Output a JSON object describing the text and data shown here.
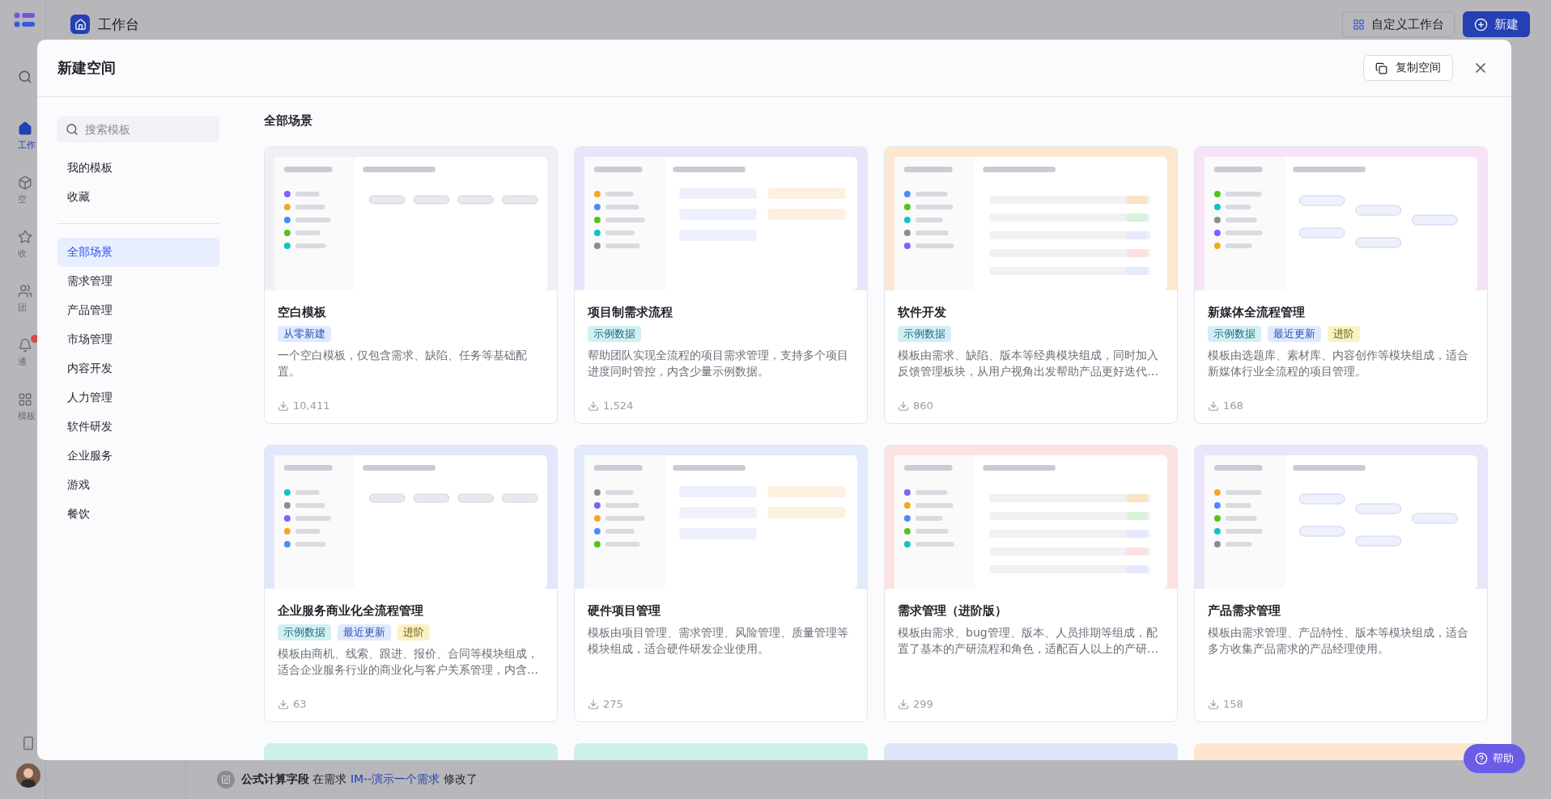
{
  "app": {
    "rail": [
      {
        "label": "工作",
        "selected": true
      },
      {
        "label": "空",
        "selected": false
      },
      {
        "label": "收",
        "selected": false
      },
      {
        "label": "团",
        "selected": false
      },
      {
        "label": "通",
        "selected": false,
        "badge": true
      },
      {
        "label": "模板",
        "selected": false
      }
    ],
    "topbar": {
      "title": "工作台",
      "customize_button": "自定义工作台",
      "new_button": "新建"
    },
    "activity": {
      "field": "公式计算字段",
      "middle": "在需求",
      "link": "IM--演示一个需求",
      "action": "修改了"
    },
    "help_button": "帮助"
  },
  "modal": {
    "title": "新建空间",
    "copy_button": "复制空间",
    "search": {
      "placeholder": "搜索模板"
    },
    "personal_items": [
      {
        "label": "我的模板"
      },
      {
        "label": "收藏"
      }
    ],
    "categories": [
      {
        "label": "全部场景",
        "selected": true
      },
      {
        "label": "需求管理",
        "selected": false
      },
      {
        "label": "产品管理",
        "selected": false
      },
      {
        "label": "市场管理",
        "selected": false
      },
      {
        "label": "内容开发",
        "selected": false
      },
      {
        "label": "人力管理",
        "selected": false
      },
      {
        "label": "软件研发",
        "selected": false
      },
      {
        "label": "企业服务",
        "selected": false
      },
      {
        "label": "游戏",
        "selected": false
      },
      {
        "label": "餐饮",
        "selected": false
      }
    ],
    "section_title": "全部场景",
    "templates": [
      {
        "title": "空白模板",
        "color": "#eef0f5",
        "tags": [
          {
            "label": "从零新建",
            "kind": "new"
          }
        ],
        "description": "一个空白模板，仅包含需求、缺陷、任务等基础配置。",
        "downloads": "10,411"
      },
      {
        "title": "项目制需求流程",
        "color": "#e7e4fb",
        "tags": [
          {
            "label": "示例数据",
            "kind": "sample"
          }
        ],
        "description": "帮助团队实现全流程的项目需求管理，支持多个项目进度同时管控，内含少量示例数据。",
        "downloads": "1,524"
      },
      {
        "title": "软件开发",
        "color": "#fde7d0",
        "tags": [
          {
            "label": "示例数据",
            "kind": "sample"
          }
        ],
        "description": "模板由需求、缺陷、版本等经典模块组成，同时加入反馈管理板块，从用户视角出发帮助产品更好迭代…",
        "downloads": "860"
      },
      {
        "title": "新媒体全流程管理",
        "color": "#f8e2f6",
        "tags": [
          {
            "label": "示例数据",
            "kind": "sample"
          },
          {
            "label": "最近更新",
            "kind": "recent"
          },
          {
            "label": "进阶",
            "kind": "advanced"
          }
        ],
        "description": "模板由选题库、素材库、内容创作等模块组成，适合新媒体行业全流程的项目管理。",
        "downloads": "168"
      },
      {
        "title": "企业服务商业化全流程管理",
        "color": "#e2e7fb",
        "tags": [
          {
            "label": "示例数据",
            "kind": "sample"
          },
          {
            "label": "最近更新",
            "kind": "recent"
          },
          {
            "label": "进阶",
            "kind": "advanced"
          }
        ],
        "description": "模板由商机、线索、跟进、报价、合同等模块组成，适合企业服务行业的商业化与客户关系管理，内含…",
        "downloads": "63"
      },
      {
        "title": "硬件项目管理",
        "color": "#e2eafb",
        "description": "模板由项目管理、需求管理、风险管理、质量管理等模块组成，适合硬件研发企业使用。",
        "downloads": "275"
      },
      {
        "title": "需求管理（进阶版）",
        "color": "#fde2e2",
        "description": "模板由需求、bug管理、版本、人员排期等组成，配置了基本的产研流程和角色，适配百人以上的产研…",
        "downloads": "299"
      },
      {
        "title": "产品需求管理",
        "color": "#ebe5fb",
        "description": "模板由需求管理、产品特性、版本等模块组成，适合多方收集产品需求的产品经理使用。",
        "downloads": "158"
      }
    ],
    "more_templates": [
      {
        "color": "#cdf1ea"
      },
      {
        "color": "#cdf1ea"
      },
      {
        "color": "#dee5f8"
      },
      {
        "color": "#fde5cb"
      }
    ]
  }
}
